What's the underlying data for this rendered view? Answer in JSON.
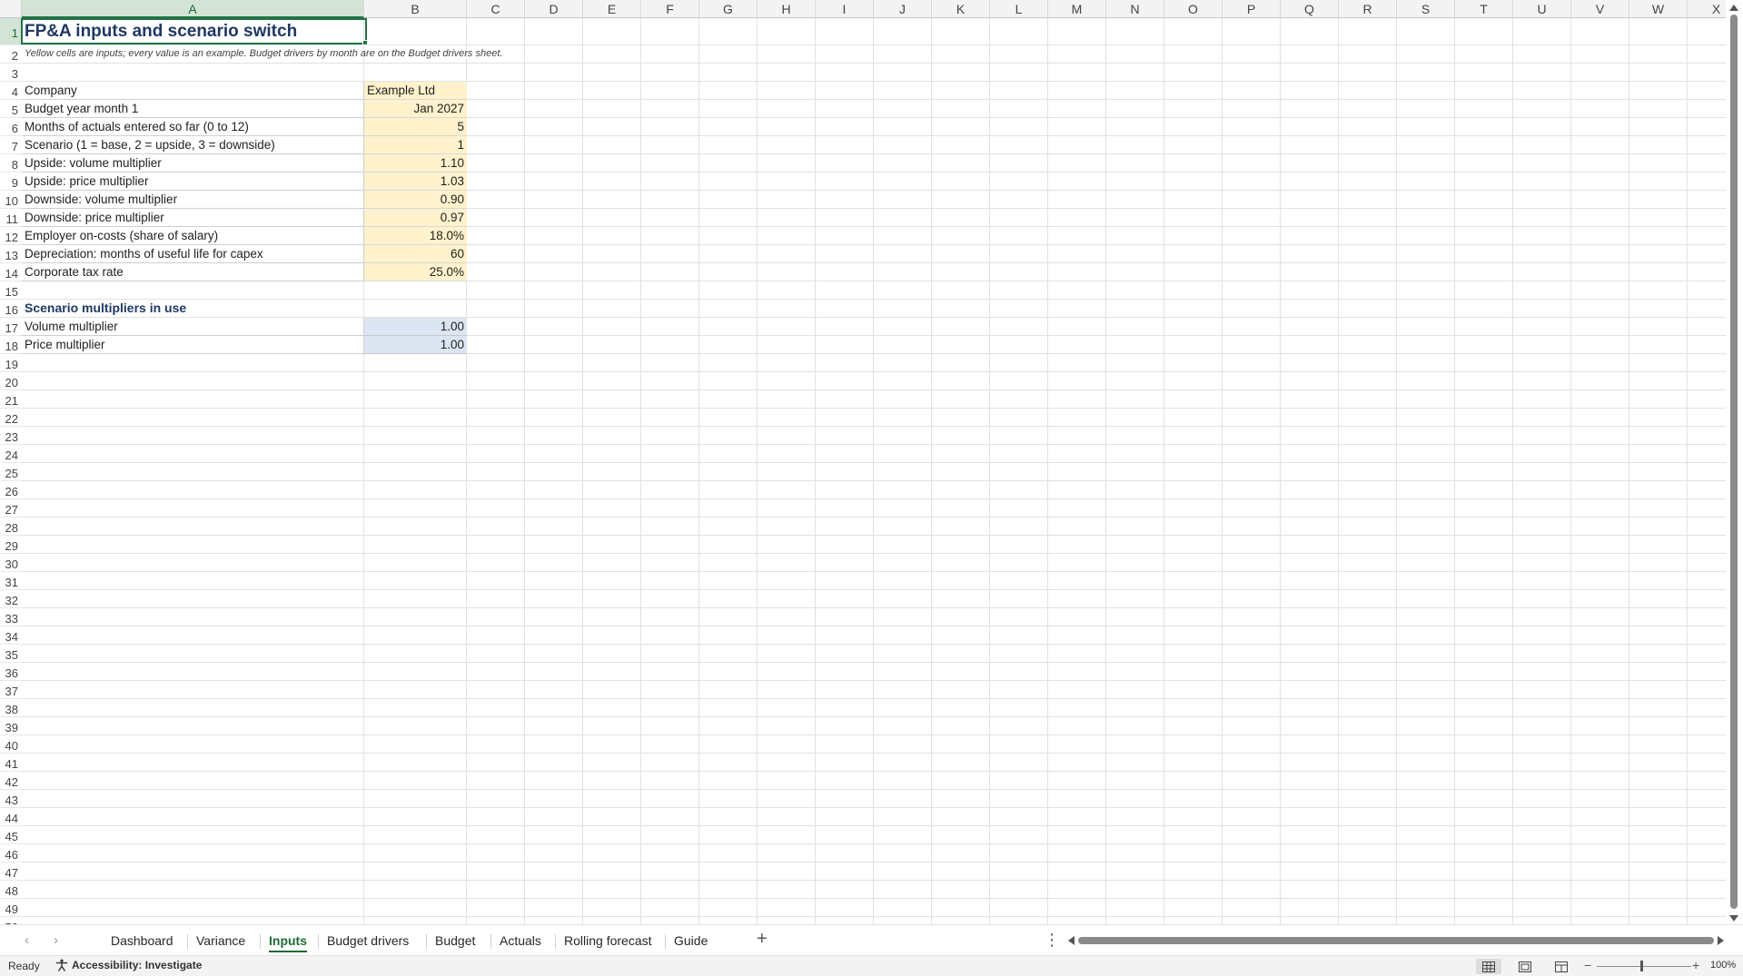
{
  "sheet": {
    "columns": [
      "A",
      "B",
      "C",
      "D",
      "E",
      "F",
      "G",
      "H",
      "I",
      "J",
      "K",
      "L",
      "M",
      "N",
      "O",
      "P",
      "Q",
      "R",
      "S",
      "T",
      "U",
      "V",
      "W",
      "X"
    ],
    "rows": [
      "1",
      "2",
      "3",
      "4",
      "5",
      "6",
      "7",
      "8",
      "9",
      "10",
      "11",
      "12",
      "13",
      "14",
      "15",
      "16",
      "17",
      "18",
      "19",
      "20",
      "21",
      "22",
      "23",
      "24",
      "25",
      "26",
      "27",
      "28",
      "29",
      "30",
      "31",
      "32",
      "33",
      "34",
      "35",
      "36",
      "37",
      "38",
      "39",
      "40",
      "41",
      "42",
      "43",
      "44",
      "45",
      "46",
      "47",
      "48",
      "49",
      "50"
    ],
    "title": "FP&A inputs and scenario switch",
    "note": "Yellow cells are inputs; every value is an example. Budget drivers by month are on the Budget drivers sheet.",
    "inputs": [
      {
        "label": "Company",
        "value": "Example Ltd"
      },
      {
        "label": "Budget year month 1",
        "value": "Jan 2027"
      },
      {
        "label": "Months of actuals entered so far (0 to 12)",
        "value": "5"
      },
      {
        "label": "Scenario (1 = base, 2 = upside, 3 = downside)",
        "value": "1"
      },
      {
        "label": "Upside: volume multiplier",
        "value": "1.10"
      },
      {
        "label": "Upside: price multiplier",
        "value": "1.03"
      },
      {
        "label": "Downside: volume multiplier",
        "value": "0.90"
      },
      {
        "label": "Downside: price multiplier",
        "value": "0.97"
      },
      {
        "label": "Employer on-costs (share of salary)",
        "value": "18.0%"
      },
      {
        "label": "Depreciation: months of useful life for capex",
        "value": "60"
      },
      {
        "label": "Corporate tax rate",
        "value": "25.0%"
      }
    ],
    "section_title": "Scenario multipliers in use",
    "multipliers": [
      {
        "label": "Volume multiplier",
        "value": "1.00"
      },
      {
        "label": "Price multiplier",
        "value": "1.00"
      }
    ],
    "colors": {
      "input_fill": "#fff2cc",
      "output_fill": "#dce6f2",
      "accent": "#217346",
      "title": "#1f3864"
    }
  },
  "tabs": {
    "items": [
      "Dashboard",
      "Variance",
      "Inputs",
      "Budget drivers",
      "Budget",
      "Actuals",
      "Rolling forecast",
      "Guide"
    ],
    "active": "Inputs",
    "prev_icon": "chevron-left-icon",
    "next_icon": "chevron-right-icon",
    "add_icon": "plus-icon",
    "more_icon": "more-vertical-icon"
  },
  "status": {
    "ready": "Ready",
    "accessibility": "Accessibility: Investigate",
    "zoom": "100%"
  }
}
